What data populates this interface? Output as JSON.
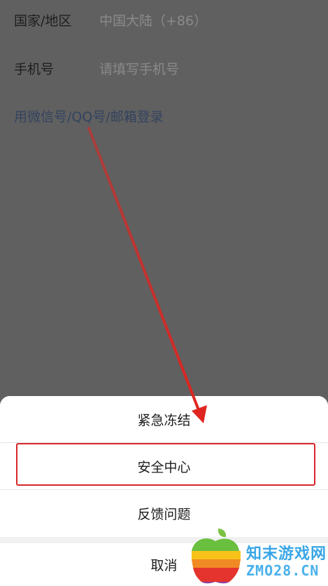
{
  "form": {
    "country_label": "国家/地区",
    "country_value": "中国大陆（+86）",
    "phone_label": "手机号",
    "phone_placeholder": "请填写手机号",
    "alt_login_link": "用微信号/QQ号/邮箱登录"
  },
  "action_sheet": {
    "items": [
      {
        "label": "紧急冻结"
      },
      {
        "label": "安全中心"
      },
      {
        "label": "反馈问题"
      }
    ],
    "cancel_label": "取消",
    "highlighted_item": "安全中心"
  },
  "annotation": {
    "arrow_color": "#e0241f",
    "highlight_color": "#d7262a"
  },
  "watermark": {
    "title": "知末游戏网",
    "domain": "ZMO28.CN"
  }
}
